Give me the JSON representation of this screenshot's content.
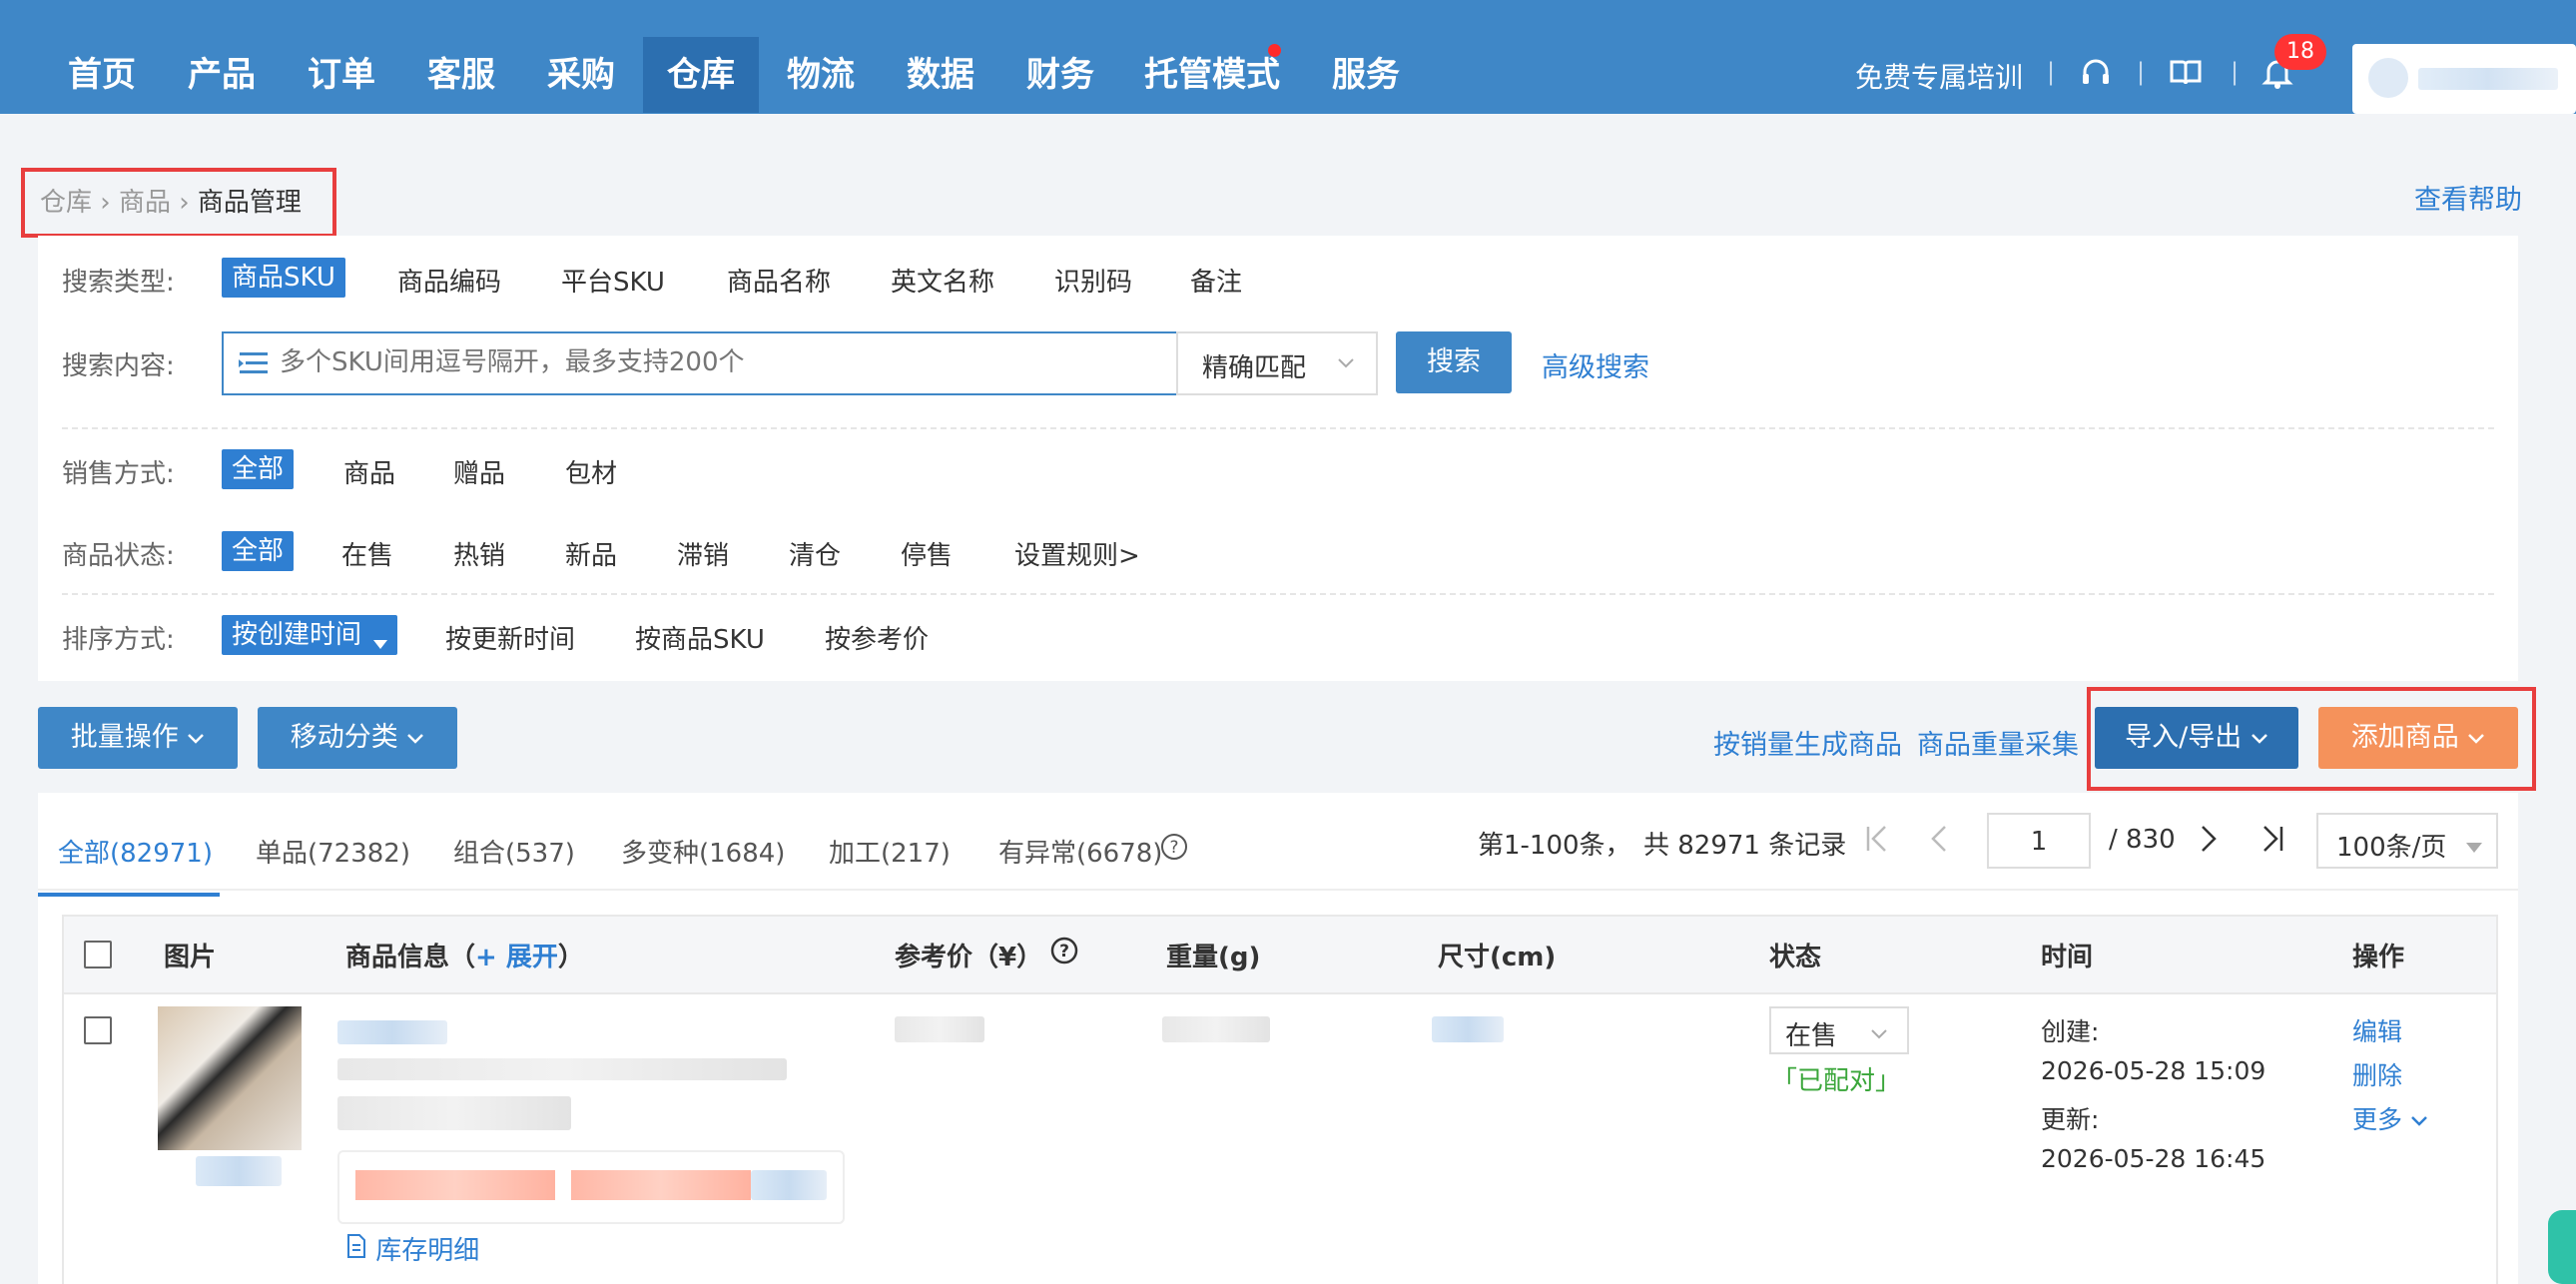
{
  "nav": {
    "items": [
      {
        "label": "首页"
      },
      {
        "label": "产品"
      },
      {
        "label": "订单"
      },
      {
        "label": "客服"
      },
      {
        "label": "采购"
      },
      {
        "label": "仓库"
      },
      {
        "label": "物流"
      },
      {
        "label": "数据"
      },
      {
        "label": "财务"
      },
      {
        "label": "托管模式"
      },
      {
        "label": "服务"
      }
    ],
    "active": "仓库",
    "training": "免费专属培训",
    "notification_count": "18",
    "icons": [
      "headset-icon",
      "book-icon",
      "bell-icon"
    ]
  },
  "breadcrumb": {
    "items": [
      "仓库",
      "商品",
      "商品管理"
    ]
  },
  "help_link": "查看帮助",
  "filters": {
    "search_type": {
      "label": "搜索类型:",
      "options": [
        "商品SKU",
        "商品编码",
        "平台SKU",
        "商品名称",
        "英文名称",
        "识别码",
        "备注"
      ],
      "selected": "商品SKU"
    },
    "search_content": {
      "label": "搜索内容:",
      "placeholder": "多个SKU间用逗号隔开，最多支持200个",
      "match_mode": "精确匹配",
      "search_button": "搜索",
      "advanced_link": "高级搜索"
    },
    "sale_mode": {
      "label": "销售方式:",
      "options": [
        "全部",
        "商品",
        "赠品",
        "包材"
      ],
      "selected": "全部"
    },
    "product_status": {
      "label": "商品状态:",
      "options": [
        "全部",
        "在售",
        "热销",
        "新品",
        "滞销",
        "清仓",
        "停售"
      ],
      "selected": "全部",
      "rules_link": "设置规则>"
    },
    "sort": {
      "label": "排序方式:",
      "options": [
        "按创建时间",
        "按更新时间",
        "按商品SKU",
        "按参考价"
      ],
      "selected": "按创建时间"
    }
  },
  "actions": {
    "batch": "批量操作",
    "move_category": "移动分类",
    "generate_by_sales": "按销量生成商品",
    "weight_collect": "商品重量采集",
    "import_export": "导入/导出",
    "add_product": "添加商品"
  },
  "tabs": [
    {
      "label": "全部(82971)"
    },
    {
      "label": "单品(72382)"
    },
    {
      "label": "组合(537)"
    },
    {
      "label": "多变种(1684)"
    },
    {
      "label": "加工(217)"
    },
    {
      "label": "有异常(6678)"
    }
  ],
  "pagination": {
    "range": "第1-100条，",
    "total": "共 82971 条记录",
    "current_page": "1",
    "total_pages": "/ 830",
    "page_size": "100条/页"
  },
  "table": {
    "headers": {
      "image": "图片",
      "info": "商品信息（",
      "expand": "+ 展开",
      "info_close": "）",
      "price": "参考价（¥）",
      "weight": "重量(g)",
      "size": "尺寸(cm)",
      "status": "状态",
      "time": "时间",
      "ops": "操作"
    },
    "rows": [
      {
        "status": "在售",
        "matched": "「已配对」",
        "created_label": "创建:",
        "created": "2026-05-28 15:09",
        "updated_label": "更新:",
        "updated": "2026-05-28 16:45",
        "stock_link": "库存明细",
        "ops": [
          "编辑",
          "删除",
          "更多"
        ]
      }
    ]
  },
  "colors": {
    "nav_bg": "#3f87c7",
    "nav_active": "#2c6fb0",
    "accent": "#2f7fd2",
    "orange": "#f5925b",
    "highlight_red": "#e83e3e",
    "matched_green": "#3aa63a"
  }
}
